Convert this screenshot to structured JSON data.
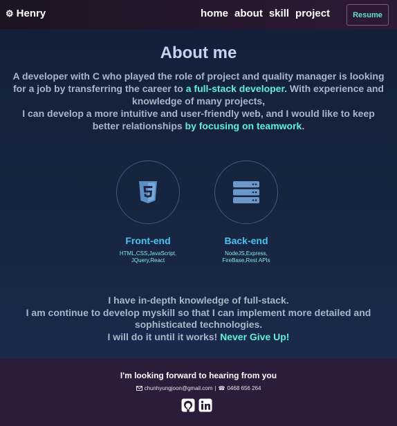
{
  "navbar": {
    "brand_icon": "gear-icon",
    "brand_name": "Henry",
    "links": [
      "home",
      "about",
      "skill",
      "project"
    ],
    "resume_label": "Resume"
  },
  "about": {
    "title": "About me",
    "intro_1": "A developer with C who played the role of project and quality manager is looking for a job by transferring the career to ",
    "intro_hl_1": "a full-stack developer.",
    "intro_2": " With experience and knowledge of many projects,",
    "intro_3": "I can develop a more intuitive and user-friendly web, and I would like to keep better relationships ",
    "intro_hl_2": "by focusing on teamwork",
    "intro_4": "."
  },
  "skills": [
    {
      "icon": "html5-icon",
      "title": "Front-end",
      "desc_line1": "HTML,CSS,JavaScript,",
      "desc_line2": "JQuery,React"
    },
    {
      "icon": "server-icon",
      "title": "Back-end",
      "desc_line1": "NodeJS,Express,",
      "desc_line2": "FireBase,Rest APIs"
    }
  ],
  "closing": {
    "line1": "I have in-depth knowledge of full-stack.",
    "line2": "I am continue to develop myskill so that I can implement more detailed and sophisticated technologies.",
    "line3": "I will do it until it works! ",
    "line3_hl": "Never Give Up!"
  },
  "footer": {
    "title": "I'm looking forward to hearing from you",
    "email_icon": "envelope-icon",
    "email": "chunhyungjoon@gmail.com",
    "separator": "|",
    "phone_icon": "phone-icon",
    "phone": "0468 656 264",
    "socials": [
      "github-icon",
      "linkedin-icon"
    ]
  },
  "colors": {
    "accent": "#5ef0d8",
    "skill_title": "#46c5f5",
    "navbar_bg": "#221628",
    "footer_bg": "#2c1c39",
    "main_bg": "#17243f"
  }
}
